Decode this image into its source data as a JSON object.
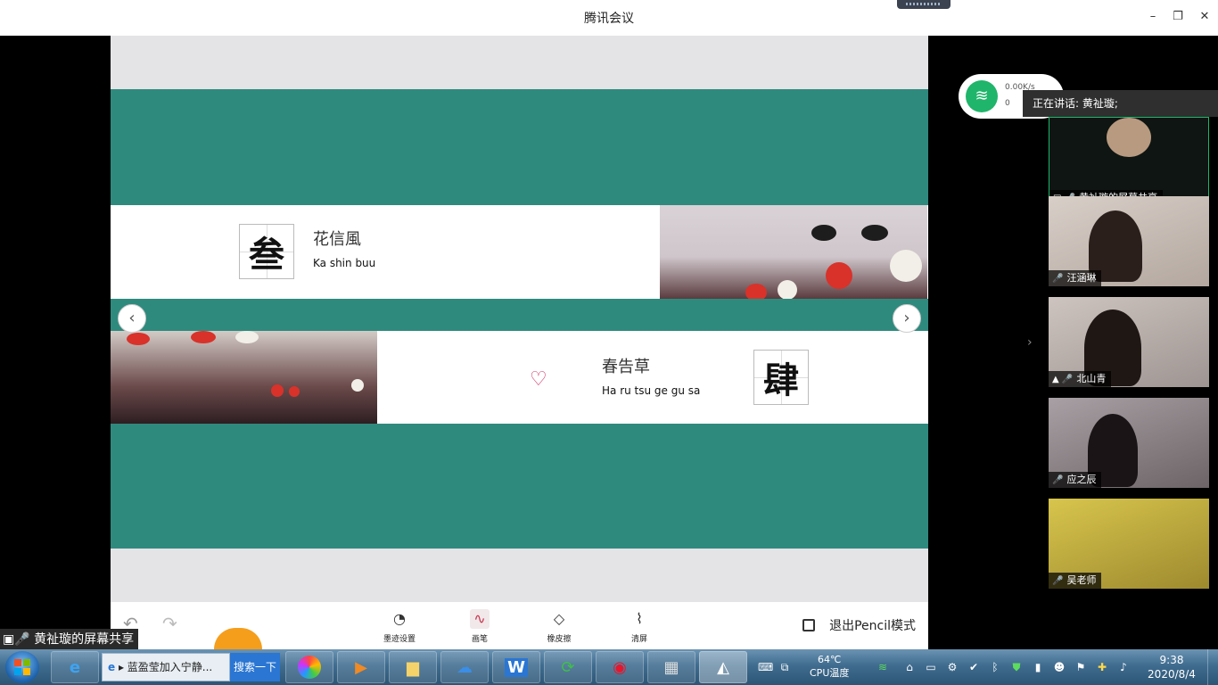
{
  "window": {
    "title": "腾讯会议",
    "minimize": "–",
    "maximize": "❐",
    "close": "✕"
  },
  "slide": {
    "row1": {
      "kanji": "叁",
      "title": "花信風",
      "romaji": "Ka shin buu"
    },
    "row2": {
      "kanji": "肆",
      "title": "春告草",
      "romaji": "Ha ru tsu ge gu sa"
    },
    "prev_arrow": "‹",
    "next_arrow": "›"
  },
  "toolbar": {
    "undo": "↶",
    "redo": "↷",
    "tools": [
      {
        "label": "墨迹设置",
        "icon": "palette-icon",
        "glyph": "◔"
      },
      {
        "label": "画笔",
        "icon": "pen-icon",
        "glyph": "∿"
      },
      {
        "label": "橡皮擦",
        "icon": "eraser-icon",
        "glyph": "◇"
      },
      {
        "label": "清屏",
        "icon": "broom-icon",
        "glyph": "⌇"
      }
    ],
    "exit_label": "退出Pencil模式"
  },
  "screen_share_label": "黄祉璇的屏幕共享",
  "network": {
    "up": "0.00K/s",
    "down": "0"
  },
  "speaking_now": "正在讲话: 黄祉璇;",
  "participants": [
    {
      "name": "黄祉璇的屏幕共享",
      "muted": false,
      "color": "#0f1512"
    },
    {
      "name": "汪涵琳",
      "muted": true,
      "color": "#c8bcb4"
    },
    {
      "name": "北山青",
      "muted": false,
      "color": "#b9b0ad"
    },
    {
      "name": "应之辰",
      "muted": false,
      "color": "#8f8a8c"
    },
    {
      "name": "吴老师",
      "muted": true,
      "color": "#cbb84a"
    }
  ],
  "taskbar": {
    "ie_task_label": "蓝盈莹加入宁静...",
    "search_label": "搜索一下",
    "cpu_temp": "64℃",
    "cpu_label": "CPU温度",
    "time": "9:38",
    "date": "2020/8/4"
  }
}
